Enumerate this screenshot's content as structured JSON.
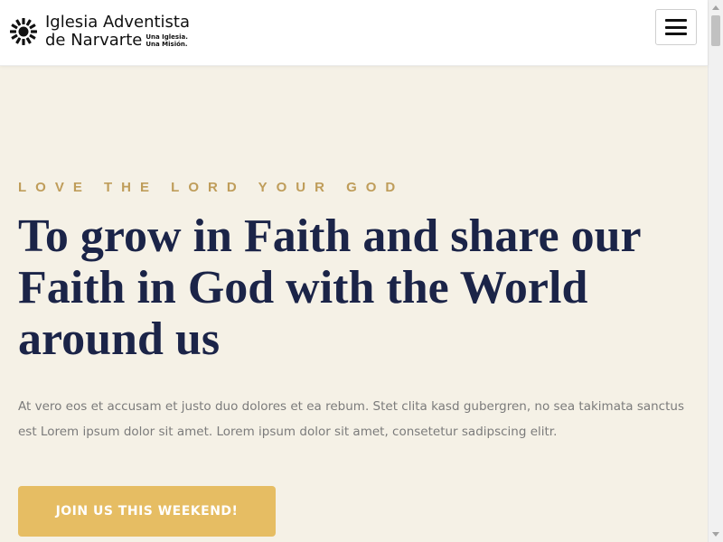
{
  "header": {
    "logo": {
      "icon": "sunburst-logo-icon",
      "line1": "Iglesia Adventista",
      "line2": "de Narvarte",
      "tagline_1": "Una Iglesia.",
      "tagline_2": "Una Misión."
    },
    "menu_icon": "hamburger-menu-icon"
  },
  "hero": {
    "eyebrow": "LOVE THE LORD YOUR GOD",
    "headline": "To grow in Faith and share our Faith in God with the World around us",
    "body": "At vero eos et accusam et justo duo dolores et ea rebum. Stet clita kasd gubergren, no sea takimata sanctus est Lorem ipsum dolor sit amet. Lorem ipsum dolor sit amet, consetetur sadipscing elitr.",
    "cta_label": "JOIN US THIS WEEKEND!"
  },
  "colors": {
    "hero_background": "#f5f1e6",
    "eyebrow": "#bf9d5a",
    "headline": "#1b2448",
    "body_text": "#7b7b7b",
    "cta_background": "#e6bd63",
    "cta_text": "#ffffff"
  }
}
